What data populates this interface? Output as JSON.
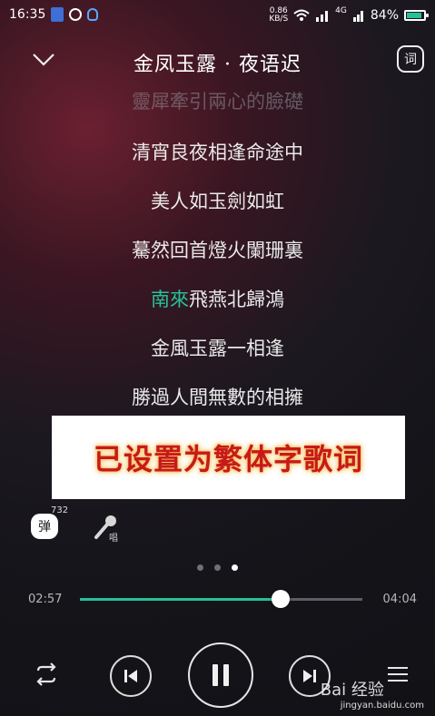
{
  "status_bar": {
    "time": "16:35",
    "net_speed_value": "0.86",
    "net_speed_unit": "KB/S",
    "battery": "84%",
    "signal_4g": "4G"
  },
  "header": {
    "title": "金凤玉露 · 夜语迟",
    "lyrics_button_label": "词"
  },
  "lyrics": [
    {
      "text": "靈犀牽引兩心的臉礎"
    },
    {
      "text": "清宵良夜相逢命途中"
    },
    {
      "text": "美人如玉劍如虹"
    },
    {
      "text": "驀然回首燈火闌珊裏"
    },
    {
      "sung": "南來",
      "rest": "飛燕北歸鴻"
    },
    {
      "text": "金風玉露一相逢"
    },
    {
      "text": "勝過人間無數的相擁"
    }
  ],
  "overlay": {
    "text": "已设置为繁体字歌词"
  },
  "tools": {
    "comment_label": "弹",
    "comment_count": "732",
    "sing_label": "唱"
  },
  "pager": {
    "count": 3,
    "active_index": 2
  },
  "progress": {
    "current": "02:57",
    "total": "04:04",
    "fraction": 0.71
  },
  "watermark": {
    "brand": "Bai 经验",
    "url": "jingyan.baidu.com"
  },
  "colors": {
    "accent": "#25c29b",
    "overlay_text": "#c7191d",
    "overlay_glow": "#f4c15b"
  }
}
